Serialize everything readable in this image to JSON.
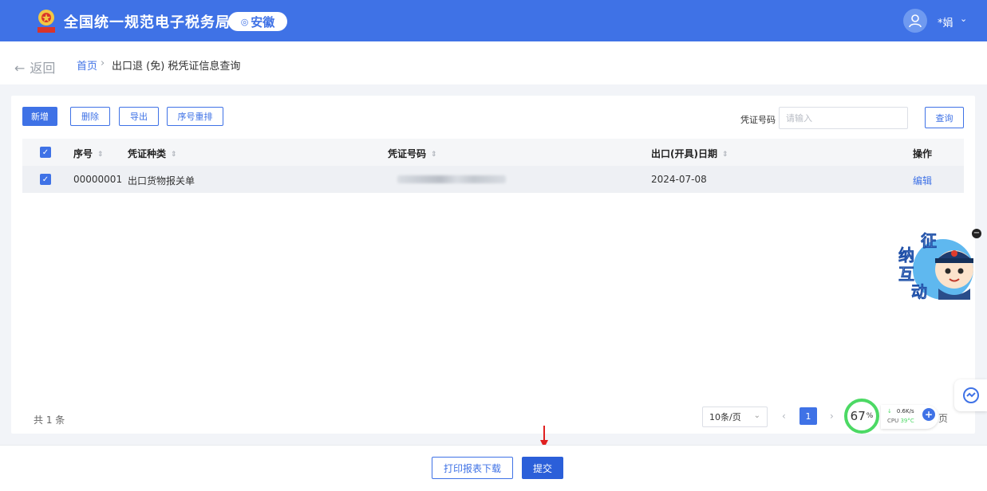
{
  "header": {
    "site_title": "全国统一规范电子税务局",
    "region": "安徽",
    "user_name": "*娟",
    "emblem_text": "中国税务"
  },
  "breadcrumb": {
    "back_label": "返回",
    "home": "首页",
    "separator": "›",
    "current": "出口退 (免) 税凭证信息查询"
  },
  "toolbar": {
    "add": "新增",
    "delete": "删除",
    "export": "导出",
    "reorder": "序号重排",
    "search_label": "凭证号码",
    "search_placeholder": "请输入",
    "search_value": "",
    "query": "查询"
  },
  "table": {
    "columns": [
      "序号",
      "凭证种类",
      "凭证号码",
      "出口(开具)日期",
      "操作"
    ],
    "rows": [
      {
        "seq": "00000001",
        "type": "出口货物报关单",
        "voucher_no": "",
        "date": "2024-07-08",
        "action": "编辑",
        "checked": true
      }
    ]
  },
  "pagination": {
    "total": "共 1 条",
    "page_size": "10条/页",
    "current_page": "1",
    "tail": "页"
  },
  "widgets": {
    "perf_value": "67",
    "perf_unit": "%",
    "net_speed": "0.6K/s",
    "cpu_label": "CPU",
    "cpu_temp": "39°C",
    "assistant_chars": [
      "征",
      "纳",
      "互",
      "动"
    ]
  },
  "footer": {
    "print": "打印报表下载",
    "submit": "提交"
  },
  "colors": {
    "primary": "#3f72e6",
    "submit": "#2b5fd9",
    "perf_ring": "#4cd964",
    "arrow": "#e02020"
  }
}
